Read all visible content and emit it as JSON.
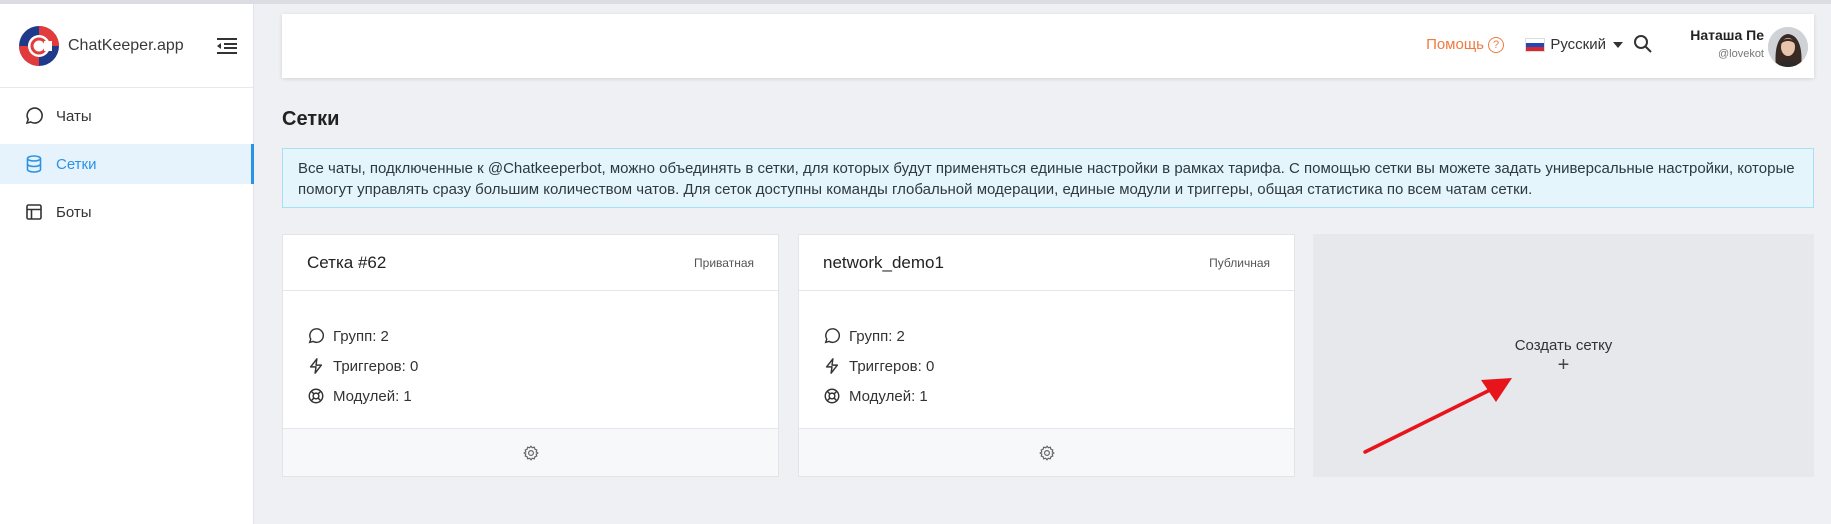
{
  "brand": {
    "name": "ChatKeeper.app"
  },
  "sidebar": {
    "items": [
      {
        "label": "Чаты",
        "icon": "chat-bubble-icon",
        "active": false
      },
      {
        "label": "Сетки",
        "icon": "database-icon",
        "active": true
      },
      {
        "label": "Боты",
        "icon": "layout-icon",
        "active": false
      }
    ]
  },
  "header": {
    "help_label": "Помощь",
    "language_label": "Русский",
    "user_name": "Наташа Пе",
    "user_handle": "@lovekot"
  },
  "page": {
    "title": "Сетки",
    "info_text": "Все чаты, подключенные к @Chatkeeperbot, можно объединять в сетки, для которых будут применяться единые настройки в рамках тарифа. С помощью сетки вы можете задать универсальные настройки, которые помогут управлять сразу большим количеством чатов. Для сеток доступны команды глобальной модерации, единые модули и триггеры, общая статистика по всем чатам сетки."
  },
  "networks": [
    {
      "title": "Сетка #62",
      "badge": "Приватная",
      "groups": "Групп: 2",
      "triggers": "Триггеров: 0",
      "modules": "Модулей: 1"
    },
    {
      "title": "network_demo1",
      "badge": "Публичная",
      "groups": "Групп: 2",
      "triggers": "Триггеров: 0",
      "modules": "Модулей: 1"
    }
  ],
  "create": {
    "label": "Создать сетку",
    "plus": "+"
  },
  "colors": {
    "accent": "#2a93e6",
    "help": "#f07a40",
    "info_bg": "#e4f5fc",
    "arrow": "#e8141b"
  }
}
